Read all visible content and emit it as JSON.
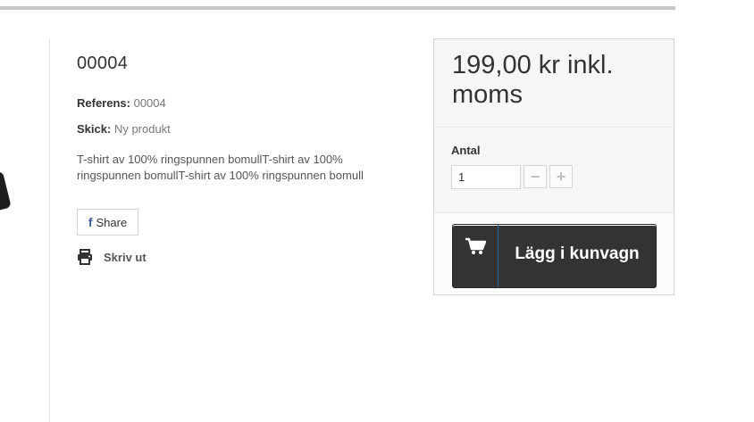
{
  "product": {
    "name": "00004",
    "reference_label": "Referens:",
    "reference_value": "00004",
    "condition_label": "Skick:",
    "condition_value": "Ny produkt",
    "description": "T-shirt av 100% ringspunnen bomullT-shirt av 100% ringspunnen bomullT-shirt av 100% ringspunnen bomull"
  },
  "social": {
    "share_label": "Share",
    "share_icon": "facebook-icon"
  },
  "print": {
    "label": "Skriv ut",
    "icon": "printer-icon"
  },
  "buy_box": {
    "price": "199,00 kr inkl. moms",
    "quantity_label": "Antal",
    "quantity_value": "1",
    "minus_symbol": "−",
    "plus_symbol": "+",
    "cart_label": "Lägg i kunvagn",
    "cart_icon": "shopping-cart-icon"
  },
  "colors": {
    "cart_button": "#333333",
    "facebook": "#3b5998",
    "cart_divider": "#1e6aa8"
  }
}
